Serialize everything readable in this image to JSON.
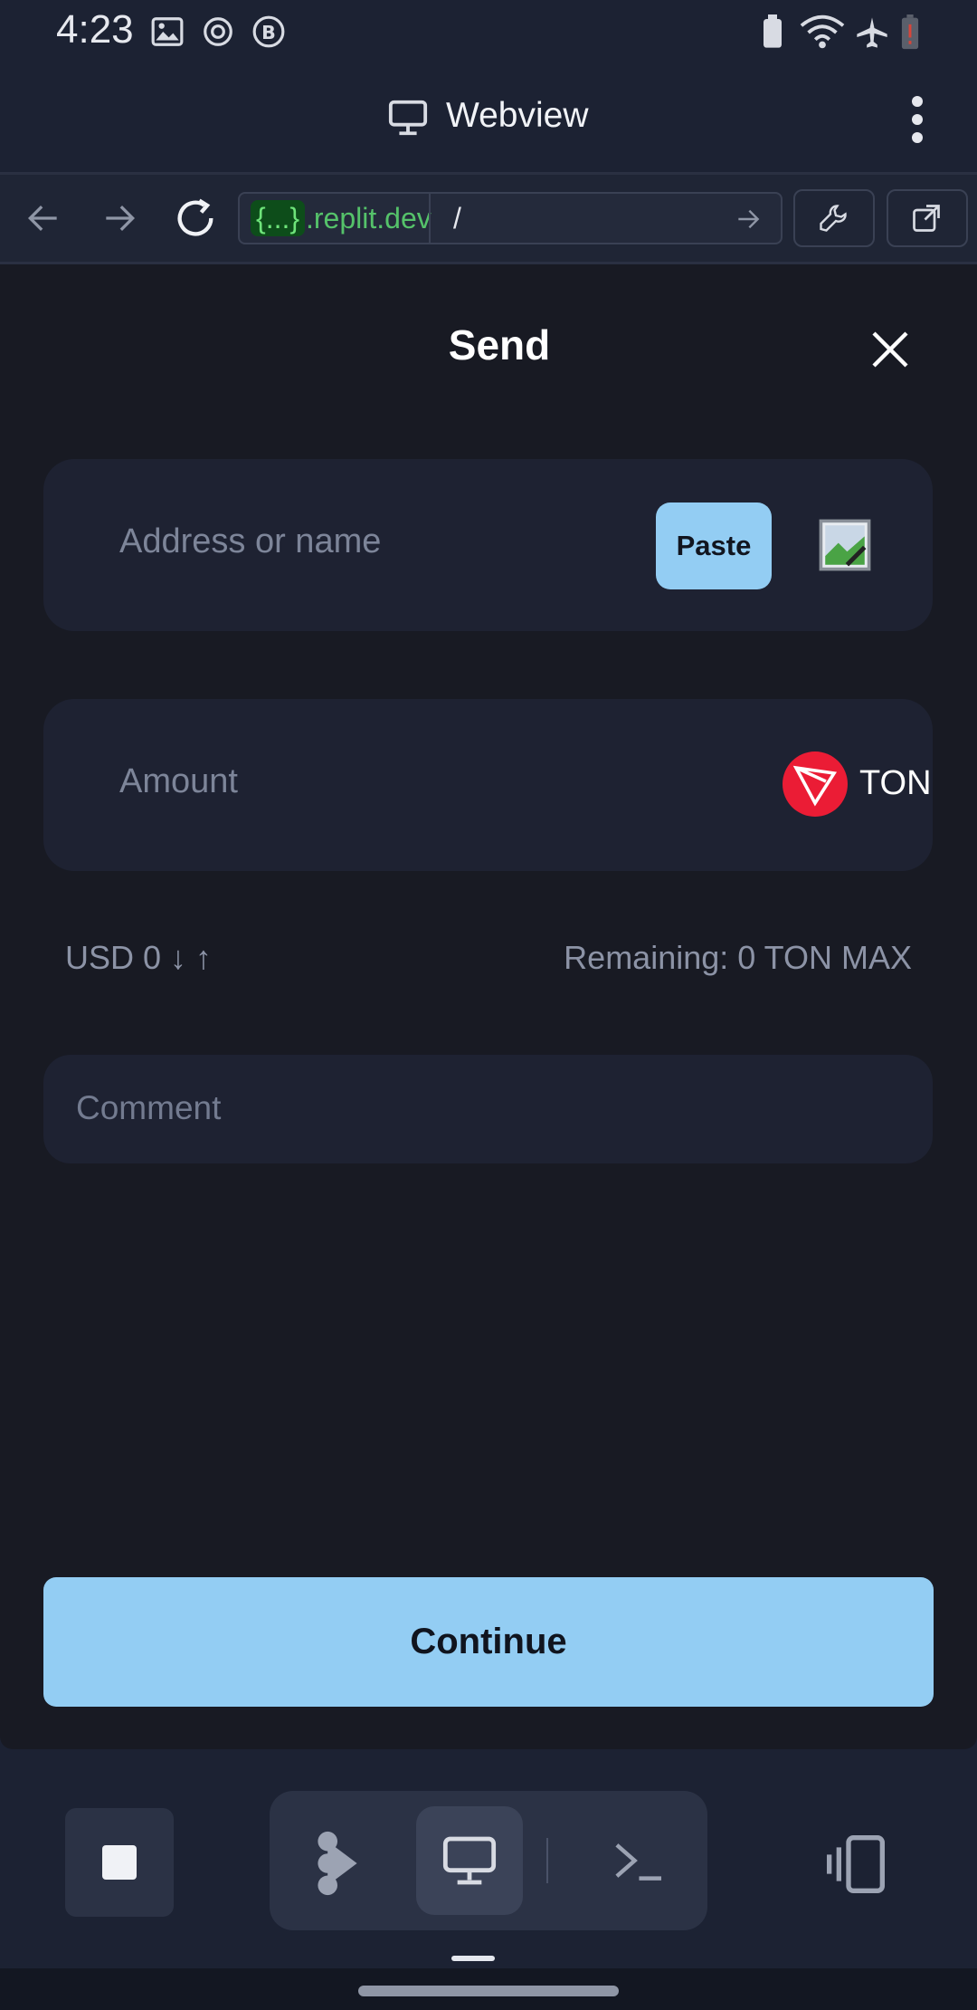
{
  "status_bar": {
    "time": "4:23"
  },
  "app_bar": {
    "title": "Webview"
  },
  "browser": {
    "url_chip": "{...}",
    "url_host": ".replit.dev",
    "url_path": "/"
  },
  "send": {
    "title": "Send",
    "address_placeholder": "Address or name",
    "paste_label": "Paste",
    "amount_placeholder": "Amount",
    "token_label": "TON",
    "usd_text": "USD 0 ↓ ↑",
    "remaining_text": "Remaining: 0 TON MAX",
    "comment_placeholder": "Comment",
    "continue_label": "Continue"
  },
  "colors": {
    "accent": "#93cdf3",
    "token": "#eb1c35",
    "background": "#181a23"
  }
}
